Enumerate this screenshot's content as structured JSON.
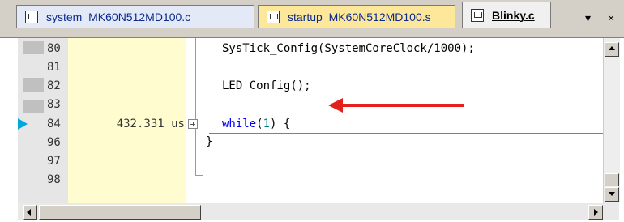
{
  "tabs": [
    {
      "label": "system_MK60N512MD100.c"
    },
    {
      "label": "startup_MK60N512MD100.s"
    },
    {
      "label": "Blinky.c",
      "active": true
    }
  ],
  "tab_controls": {
    "dropdown": "▾",
    "close": "×"
  },
  "gutter": {
    "lines": [
      "80",
      "81",
      "82",
      "83",
      "84",
      "96",
      "97",
      "98"
    ],
    "time_value": "432.331 us"
  },
  "code": {
    "line80": "SysTick_Config(SystemCoreClock/1000);",
    "line82": "LED_Config();",
    "line84_kw": "while",
    "line84_num": "1",
    "line84_rest": " {",
    "line96": "}"
  },
  "colors": {
    "accent_arrow": "#e5201b",
    "exec_marker": "#00a7d9",
    "time_bg": "#fffdd0"
  }
}
